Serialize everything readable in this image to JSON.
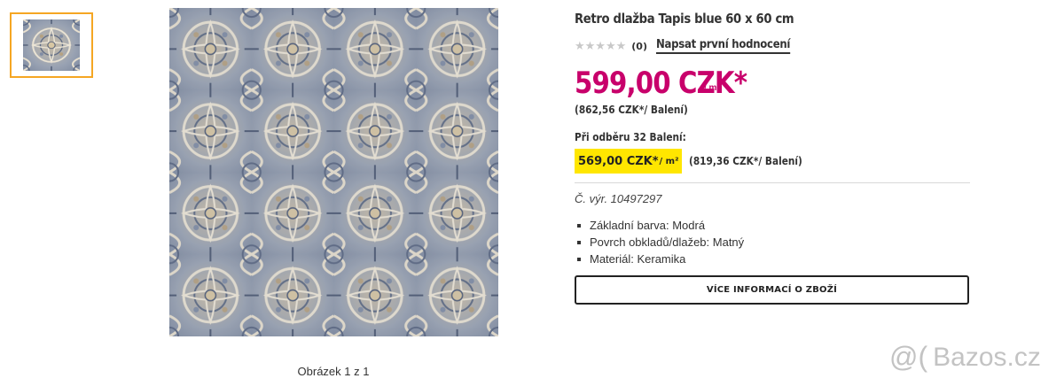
{
  "gallery": {
    "thumbnail_icon": "tile-thumbnail",
    "image_counter": "Obrázek 1 z 1"
  },
  "product": {
    "title": "Retro dlažba Tapis blue 60 x 60 cm",
    "rating": {
      "stars_filled": 0,
      "stars_total": 5,
      "stars_glyphs": "★★★★★",
      "count": "(0)",
      "write_review_link": "Napsat první hodnocení"
    },
    "price": {
      "value": "599,00 CZK*",
      "unit": "/ m²",
      "pack_price": "(862,56 CZK*/ Balení)"
    },
    "bulk": {
      "label": "Při odběru 32 Balení:",
      "value": "569,00 CZK*",
      "unit": "/ m²",
      "pack_price": "(819,36 CZK*/ Balení)"
    },
    "sku": "Č. výr. 10497297",
    "features": [
      "Základní barva: Modrá",
      "Povrch obkladů/dlažeb: Matný",
      "Materiál: Keramika"
    ],
    "more_info_button": "VÍCE INFORMACÍ O ZBOŽÍ"
  },
  "watermark": {
    "symbol": "@(",
    "text": "Bazos.cz"
  },
  "colors": {
    "price": "#c8006b",
    "highlight": "#ffe600",
    "thumb_border": "#f5a623"
  }
}
